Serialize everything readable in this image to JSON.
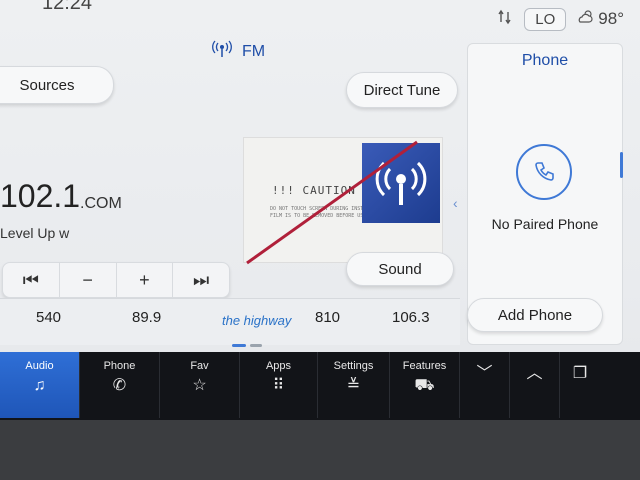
{
  "status": {
    "time": "12:24",
    "climate_level": "LO",
    "temperature": "98°"
  },
  "radio": {
    "band": "FM",
    "sources_label": "Sources",
    "direct_tune_label": "Direct Tune",
    "sound_label": "Sound",
    "frequency": "102.1",
    "frequency_suffix": ".COM",
    "rds_text": "Level Up w",
    "controls": [
      "⏮",
      "−",
      "+",
      "⏭"
    ],
    "presets": [
      "540",
      "89.9",
      "the highway",
      "810",
      "106.3"
    ],
    "caution_title": "!!! CAUTION !!!",
    "caution_fine": "DO NOT TOUCH SCREEN DURING INSTALLATION THE FILM IS TO BE REMOVED BEFORE USE"
  },
  "phone": {
    "title": "Phone",
    "status": "No Paired Phone",
    "add_label": "Add Phone"
  },
  "nav": {
    "audio": "Audio",
    "phone": "Phone",
    "fav": "Fav",
    "apps": "Apps",
    "settings": "Settings",
    "features": "Features"
  },
  "colors": {
    "accent": "#1f4ea8",
    "active_nav": "#2f6fd6",
    "nav_bg": "#121418"
  }
}
